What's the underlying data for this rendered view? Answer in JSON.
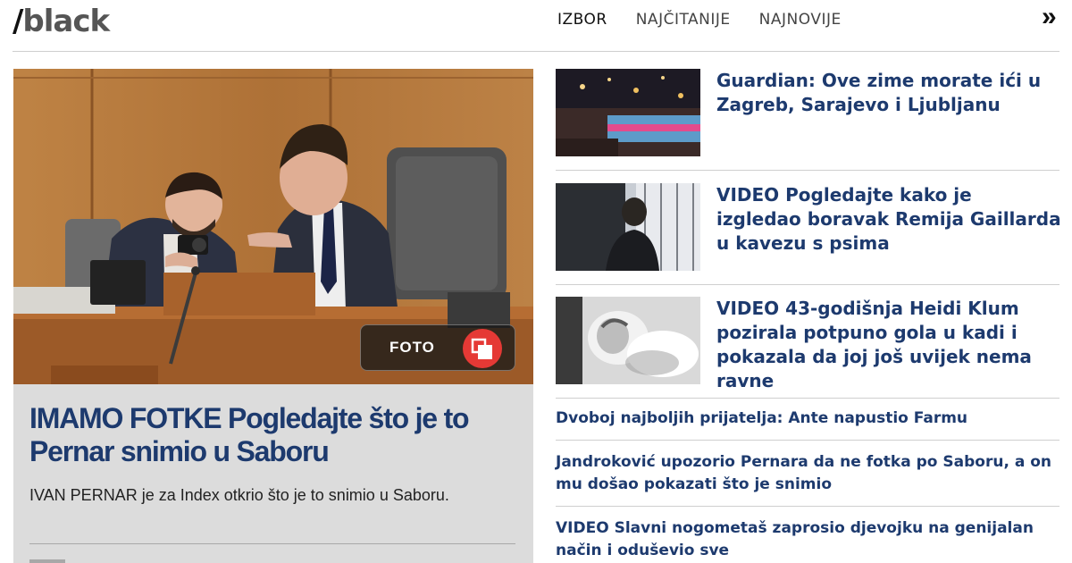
{
  "header": {
    "logo_slash": "/",
    "logo_word": "black",
    "nav": [
      "IZBOR",
      "NAJČITANIJE",
      "NAJNOVIJE"
    ],
    "more": "»"
  },
  "feature": {
    "badge_label": "FOTO",
    "title": "IMAMO FOTKE Pogledajte što je to Pernar snimio u Saboru",
    "lead": "IVAN PERNAR je za Index otkrio što je to snimio u Saboru."
  },
  "stories": [
    {
      "title": "Guardian: Ove zime morate ići u Zagreb, Sarajevo i Ljubljanu"
    },
    {
      "title": "VIDEO Pogledajte kako je izgledao boravak Remija Gaillarda u kavezu s psima"
    },
    {
      "title": "VIDEO 43-godišnja Heidi Klum pozirala potpuno gola u kadi i pokazala da joj još uvijek nema ravne"
    }
  ],
  "small_stories": [
    {
      "title": "Dvoboj najboljih prijatelja: Ante napustio Farmu"
    },
    {
      "title": "Jandroković upozorio Pernara da ne fotka po Saboru, a on mu došao pokazati što je snimio"
    },
    {
      "title": "VIDEO Slavni nogometaš zaprosio djevojku na genijalan način i oduševio sve"
    }
  ],
  "colors": {
    "headline_blue": "#1d3a6e",
    "badge_red": "#e53935",
    "feature_bg": "#dcdcdc"
  }
}
